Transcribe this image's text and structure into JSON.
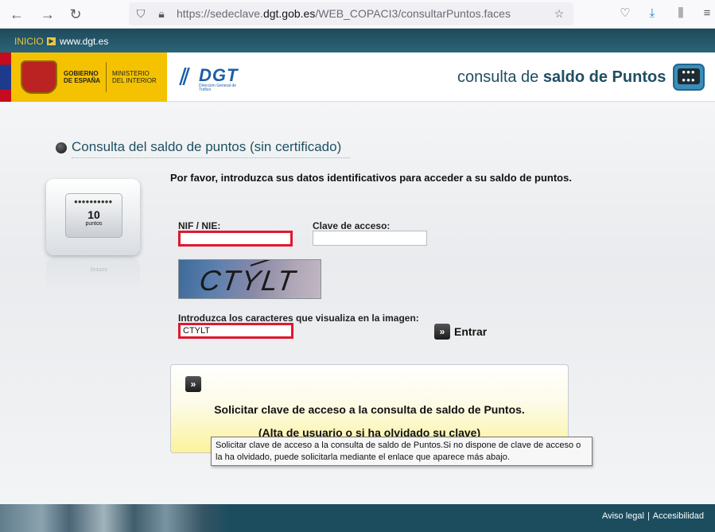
{
  "browser": {
    "url_prefix": "https://sedeclave.",
    "url_domain": "dgt.gob.es",
    "url_path": "/WEB_COPACI3/consultarPuntos.faces"
  },
  "top_strip": {
    "inicio": "INICIO",
    "site": "www.dgt.es"
  },
  "header": {
    "gov_line1": "GOBIERNO",
    "gov_line2": "DE ESPAÑA",
    "ministry_line1": "MINISTERIO",
    "ministry_line2": "DEL INTERIOR",
    "dgt": "DGT",
    "dgt_sub": "Dirección General de Tráfico",
    "title_light": "consulta de ",
    "title_bold": "saldo de Puntos"
  },
  "main": {
    "section_title": "Consulta del saldo de puntos (sin certificado)",
    "device_number": "10",
    "device_unit": "puntos",
    "intro": "Por favor, introduzca sus datos identificativos para acceder a su saldo de puntos.",
    "nif_label": "NIF / NIE:",
    "nif_value": "",
    "clave_label": "Clave de acceso:",
    "clave_value": "",
    "captcha_text": "CTYLT",
    "captcha_label": "Introduzca los caracteres que visualiza en la imagen:",
    "captcha_value": "CTYLT",
    "enter_label": "Entrar"
  },
  "info_box": {
    "title": "Solicitar clave de acceso a la consulta de saldo de Puntos.",
    "subtitle": "(Alta de usuario o si ha olvidado su clave)",
    "tooltip": "Solicitar clave de acceso a la consulta de saldo de Puntos.Si no dispone de clave de acceso o la ha olvidado, puede solicitarla mediante el enlace que aparece más abajo."
  },
  "footer": {
    "aviso": "Aviso legal",
    "separator": "|",
    "accesibilidad": "Accesibilidad"
  }
}
